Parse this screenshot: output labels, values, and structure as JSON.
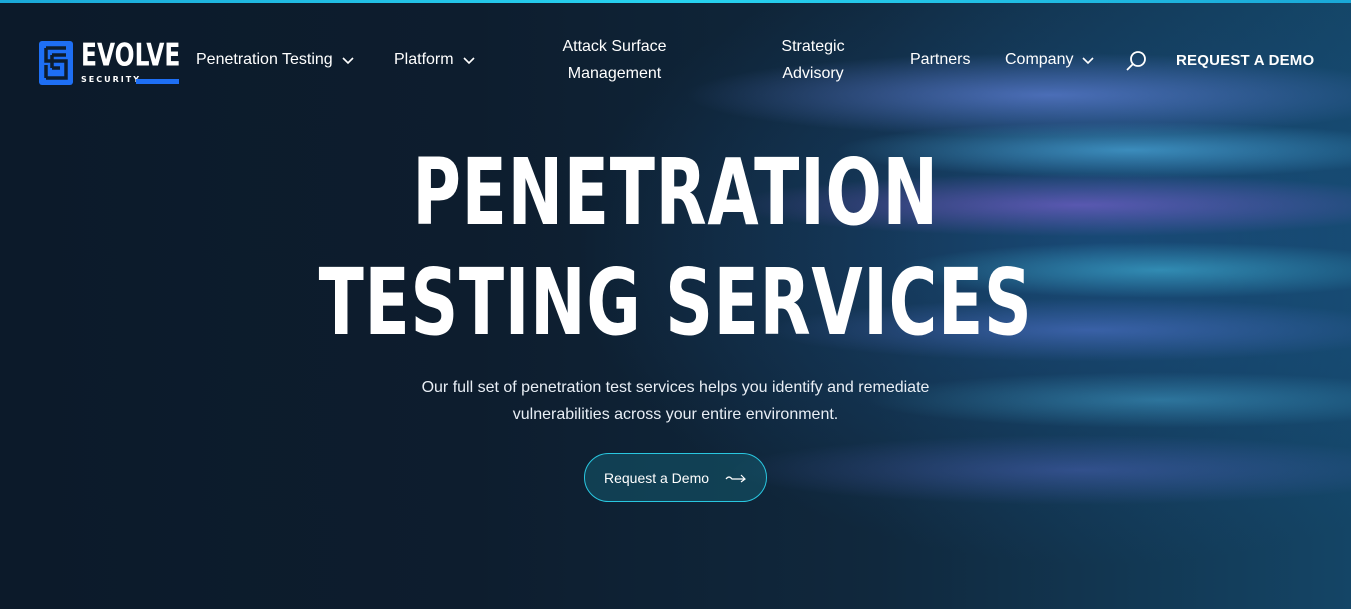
{
  "brand": {
    "name": "EVOLVE",
    "tagline": "SECURITY",
    "accent_color": "#1e6ff5"
  },
  "nav": {
    "items": [
      {
        "label": "Penetration Testing",
        "has_dropdown": true
      },
      {
        "label": "Platform",
        "has_dropdown": true
      },
      {
        "label": "Attack Surface Management",
        "has_dropdown": false
      },
      {
        "label": "Strategic Advisory",
        "has_dropdown": false
      },
      {
        "label": "Partners",
        "has_dropdown": false
      },
      {
        "label": "Company",
        "has_dropdown": true
      }
    ],
    "search_icon": "search-icon",
    "cta_label": "REQUEST A DEMO"
  },
  "hero": {
    "title_line1": "PENETRATION",
    "title_line2": "TESTING SERVICES",
    "subtitle": "Our full set of penetration test services helps you identify and remediate vulnerabilities across your entire environment.",
    "button_label": "Request a Demo",
    "button_icon": "arrow-right-icon",
    "button_border_color": "#29c7e0"
  }
}
